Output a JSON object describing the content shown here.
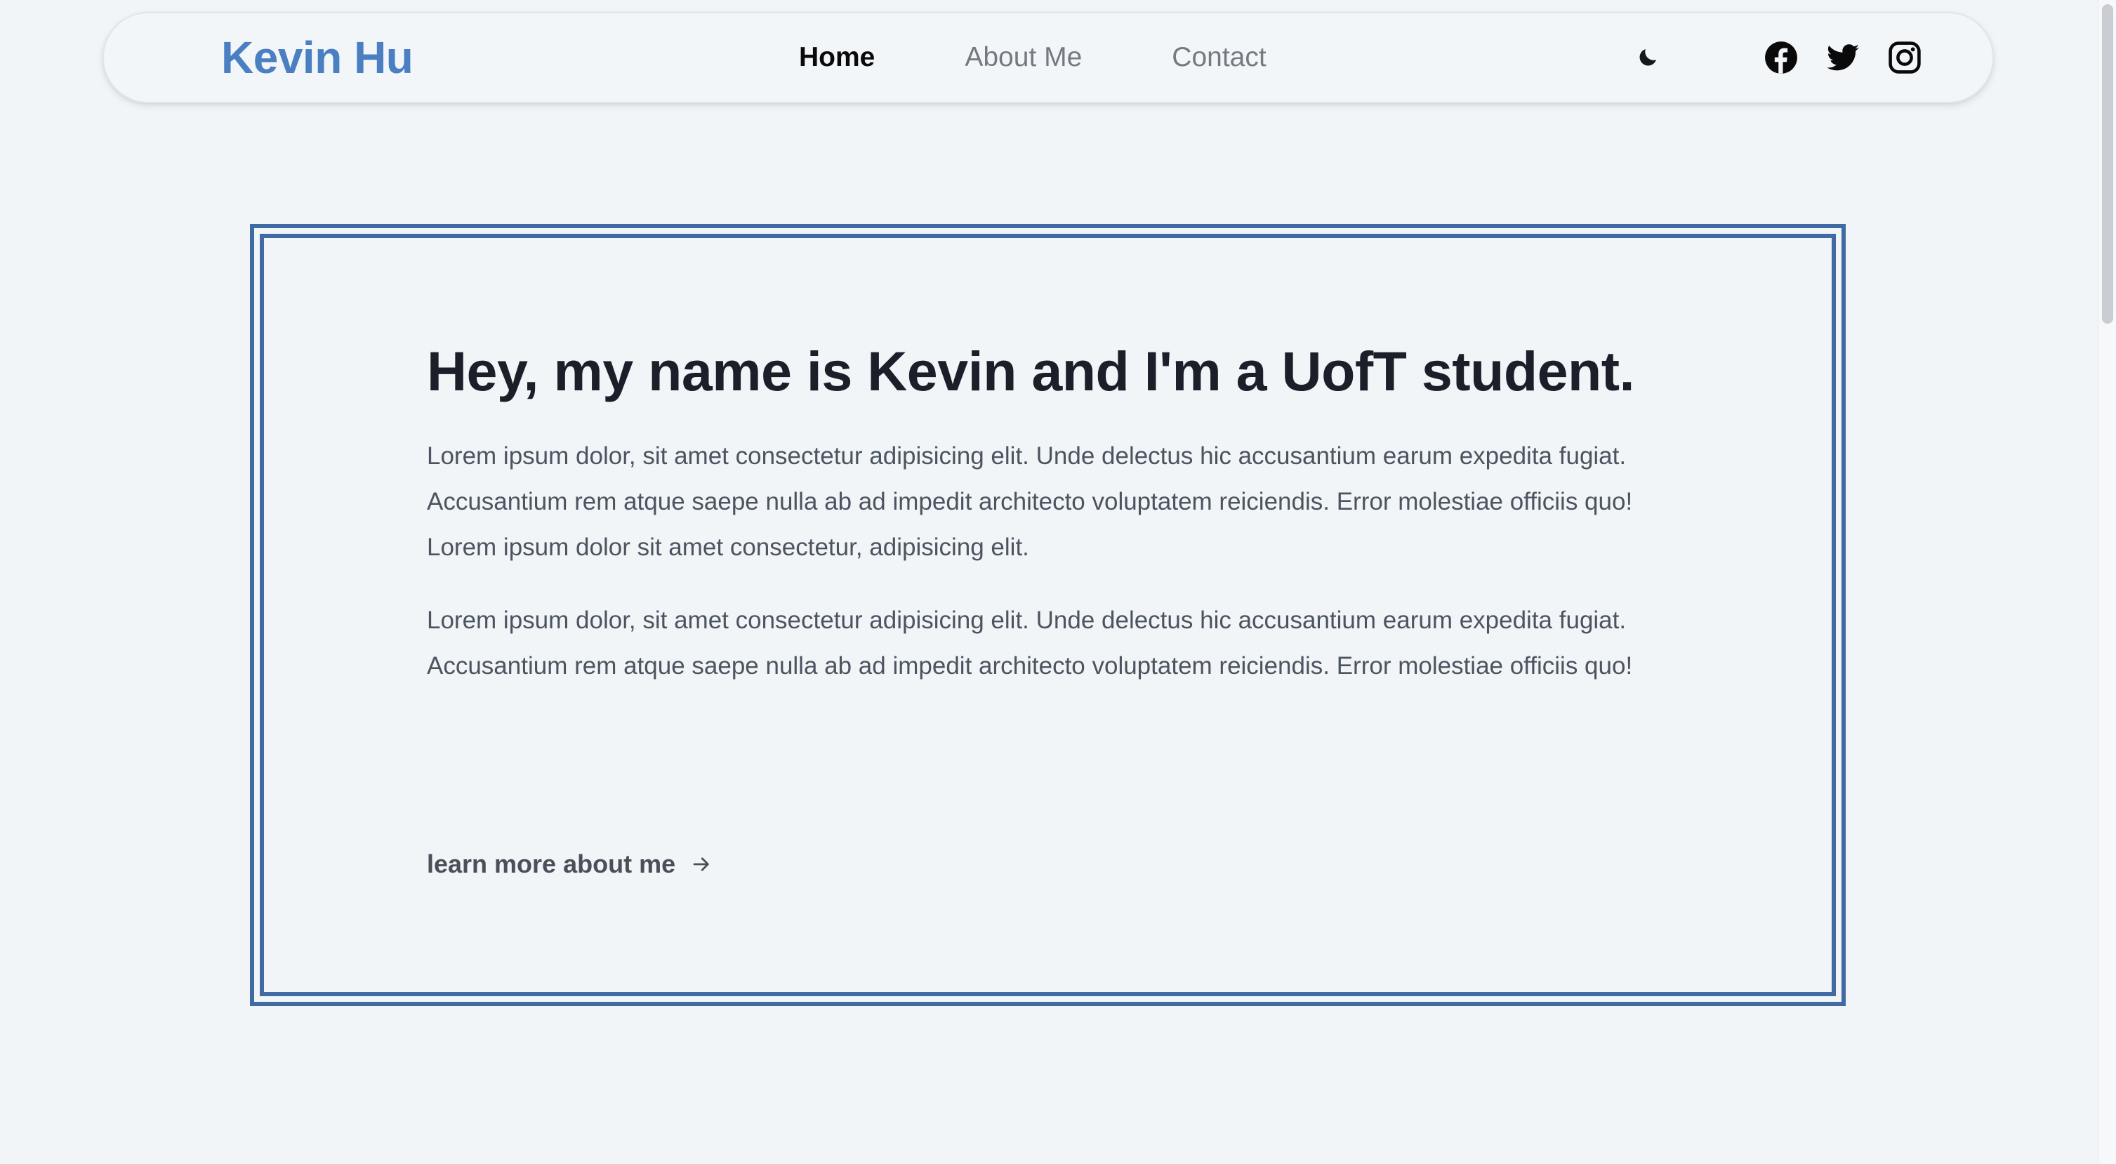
{
  "navbar": {
    "brand": "Kevin Hu",
    "links": [
      {
        "label": "Home",
        "active": true
      },
      {
        "label": "About Me",
        "active": false
      },
      {
        "label": "Contact",
        "active": false
      }
    ],
    "theme_toggle_icon": "moon-icon",
    "social_icons": [
      "facebook-icon",
      "twitter-icon",
      "instagram-icon"
    ]
  },
  "hero": {
    "title": "Hey, my name is Kevin and I'm a UofT student.",
    "paragraphs": [
      "Lorem ipsum dolor, sit amet consectetur adipisicing elit. Unde delectus hic accusantium earum expedita fugiat. Accusantium rem atque saepe nulla ab ad impedit architecto voluptatem reiciendis. Error molestiae officiis quo! Lorem ipsum dolor sit amet consectetur, adipisicing elit.",
      "Lorem ipsum dolor, sit amet consectetur adipisicing elit. Unde delectus hic accusantium earum expedita fugiat. Accusantium rem atque saepe nulla ab ad impedit architecto voluptatem reiciendis. Error molestiae officiis quo!"
    ],
    "link_label": "learn more about me",
    "link_icon": "arrow-right-icon"
  },
  "colors": {
    "background": "#f1f5f7",
    "brand": "#4a7fc1",
    "frame": "#3f6aa3",
    "heading": "#1b1f29",
    "body_text": "#4b5460",
    "nav_inactive": "#737a82"
  }
}
